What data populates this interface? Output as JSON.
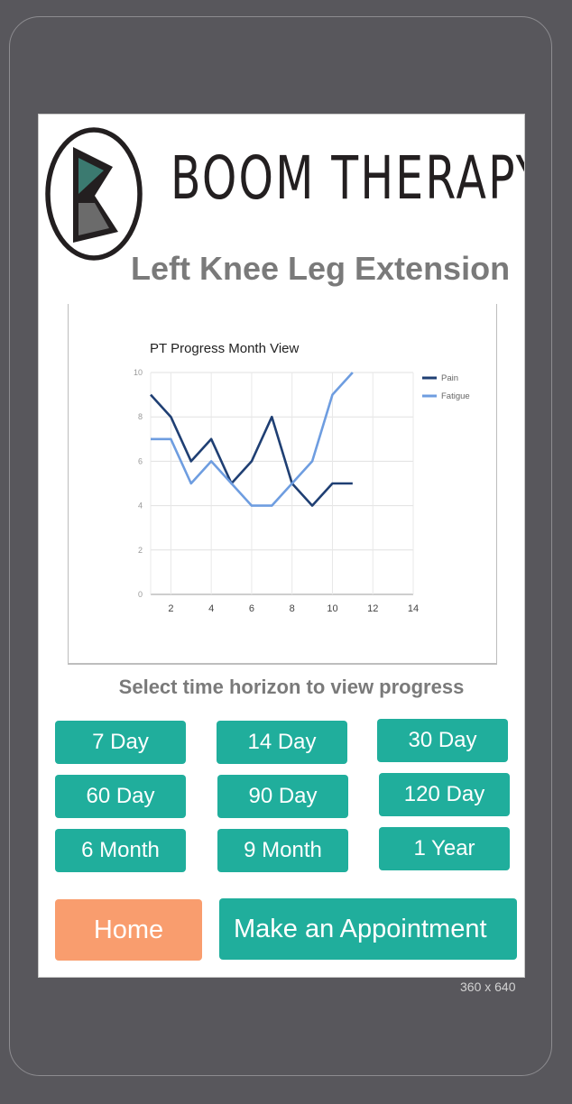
{
  "header": {
    "brand_name": "BOOM THERAPY",
    "exercise_title": "Left Knee Leg Extension"
  },
  "chart_data": {
    "type": "line",
    "title": "PT Progress Month View",
    "xlabel": "",
    "ylabel": "",
    "x": [
      1,
      2,
      3,
      4,
      5,
      6,
      7,
      8,
      9,
      10,
      11
    ],
    "xlim": [
      1,
      14
    ],
    "ylim": [
      0,
      10
    ],
    "xticks": [
      2,
      4,
      6,
      8,
      10,
      12,
      14
    ],
    "yticks": [
      0,
      2,
      4,
      6,
      8,
      10
    ],
    "grid": true,
    "legend_position": "right",
    "series": [
      {
        "name": "Pain",
        "color": "#1f3f73",
        "values": [
          9,
          8,
          6,
          7,
          5,
          6,
          8,
          5,
          4,
          5,
          5
        ]
      },
      {
        "name": "Fatigue",
        "color": "#6e9de0",
        "values": [
          7,
          7,
          5,
          6,
          5,
          4,
          4,
          5,
          6,
          9,
          10
        ]
      }
    ]
  },
  "time_horizon": {
    "label": "Select time horizon to view progress",
    "options": [
      "7 Day",
      "14 Day",
      "30 Day",
      "60 Day",
      "90 Day",
      "120 Day",
      "6 Month",
      "9 Month",
      "1 Year"
    ]
  },
  "actions": {
    "home_label": "Home",
    "appointment_label": "Make an Appointment"
  },
  "device": {
    "size_label": "360 x 640"
  },
  "colors": {
    "accent": "#20ae9c",
    "home": "#f99d6e",
    "frame": "#58575c"
  }
}
